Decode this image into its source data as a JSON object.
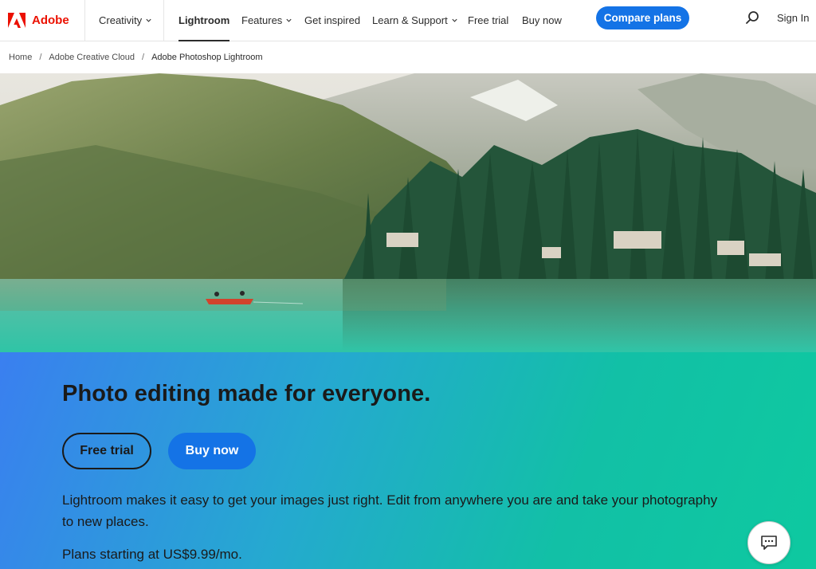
{
  "nav": {
    "brand": "Adobe",
    "creativity": "Creativity",
    "lightroom": "Lightroom",
    "features": "Features",
    "get_inspired": "Get inspired",
    "learn_support": "Learn & Support",
    "free_trial": "Free trial",
    "buy_now": "Buy now",
    "compare_plans": "Compare plans",
    "sign_in": "Sign In",
    "search_icon": "search-icon",
    "brand_color": "#eb1000",
    "accent_color": "#1473e6"
  },
  "breadcrumb": {
    "items": [
      "Home",
      "Adobe Creative Cloud",
      "Adobe Photoshop Lightroom"
    ],
    "separator": "/"
  },
  "promo": {
    "headline": "Photo editing made for everyone.",
    "free_trial_label": "Free trial",
    "buy_now_label": "Buy now",
    "description": "Lightroom makes it easy to get your images just right. Edit from anywhere you are and take your photography to new places.",
    "plans": "Plans starting at US$9.99/mo.",
    "chat_icon": "chat-icon"
  }
}
